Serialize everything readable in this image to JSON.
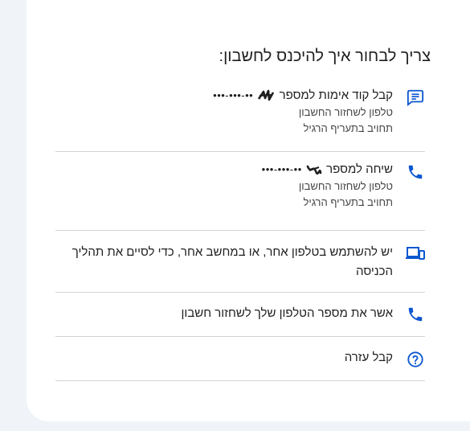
{
  "heading": "צריך לבחור איך להיכנס לחשבון:",
  "options": [
    {
      "icon": "sms-message-icon",
      "label": "קבל קוד אימות למספר",
      "masked_number": "•••-•••-••",
      "lines": [
        "טלפון לשחזור החשבון",
        "תחויב בתעריף הרגיל"
      ]
    },
    {
      "icon": "phone-call-icon",
      "label": "שיחה למספר",
      "masked_number": "•••-•••-••",
      "lines": [
        "טלפון לשחזור החשבון",
        "תחויב בתעריף הרגיל"
      ]
    },
    {
      "icon": "devices-icon",
      "label": "יש להשתמש בטלפון אחר, או במחשב אחר, כדי לסיים את תהליך הכניסה"
    },
    {
      "icon": "phone-call-icon",
      "label": "אשר את מספר הטלפון שלך לשחזור חשבון"
    },
    {
      "icon": "help-circle-icon",
      "label": "קבל עזרה"
    }
  ],
  "colors": {
    "accent": "#0b57d0",
    "text": "#1f1f1f",
    "secondary_text": "#444746",
    "divider": "#d3d3d3",
    "page_background": "#f0f4f9",
    "card_background": "#ffffff"
  }
}
